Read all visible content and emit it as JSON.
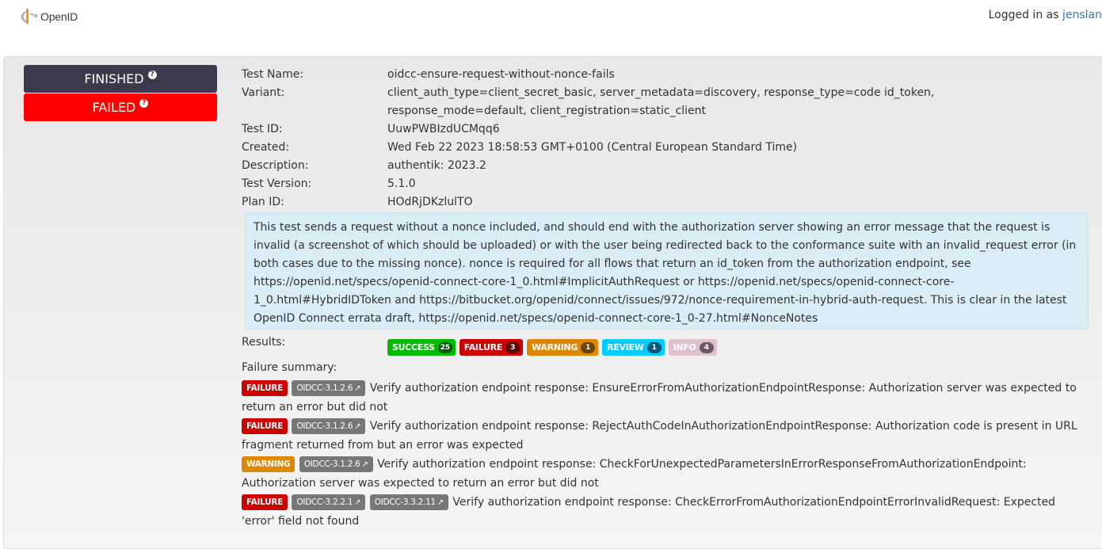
{
  "header": {
    "logo_text": "OpenID",
    "logged_in_prefix": "Logged in as",
    "username": "jenslan"
  },
  "status": {
    "run_state": "FINISHED",
    "result": "FAILED",
    "colors": {
      "finished": "#3b3a4c",
      "failed": "#ff0000"
    }
  },
  "details": [
    {
      "label": "Test Name:",
      "value": "oidcc-ensure-request-without-nonce-fails"
    },
    {
      "label": "Variant:",
      "value": "client_auth_type=client_secret_basic, server_metadata=discovery, response_type=code id_token, response_mode=default, client_registration=static_client"
    },
    {
      "label": "Test ID:",
      "value": "UuwPWBIzdUCMqq6"
    },
    {
      "label": "Created:",
      "value": "Wed Feb 22 2023 18:58:53 GMT+0100 (Central European Standard Time)"
    },
    {
      "label": "Description:",
      "value": "authentik: 2023.2"
    },
    {
      "label": "Test Version:",
      "value": "5.1.0"
    },
    {
      "label": "Plan ID:",
      "value": "HOdRjDKzlulTO"
    }
  ],
  "description_box": "This test sends a request without a nonce included, and should end with the authorization server showing an error message that the request is invalid (a screenshot of which should be uploaded) or with the user being redirected back to the conformance suite with an invalid_request error (in both cases due to the missing nonce). nonce is required for all flows that return an id_token from the authorization endpoint, see https://openid.net/specs/openid-connect-core-1_0.html#ImplicitAuthRequest or https://openid.net/specs/openid-connect-core-1_0.html#HybridIDToken and https://bitbucket.org/openid/connect/issues/972/nonce-requirement-in-hybrid-auth-request. This is clear in the latest OpenID Connect errata draft, https://openid.net/specs/openid-connect-core-1_0-27.html#NonceNotes",
  "results": {
    "label": "Results:",
    "badges": [
      {
        "label": "SUCCESS",
        "count": "25",
        "bg": "#00bb00",
        "count_bg": "#005a00",
        "fg": "#ffffff"
      },
      {
        "label": "FAILURE",
        "count": "3",
        "bg": "#cc0000",
        "count_bg": "#5e0000",
        "fg": "#ffffff"
      },
      {
        "label": "WARNING",
        "count": "1",
        "bg": "#dd8800",
        "count_bg": "#6b4200",
        "fg": "#ffffff"
      },
      {
        "label": "REVIEW",
        "count": "1",
        "bg": "#00ccff",
        "count_bg": "#005a75",
        "fg": "#ffffff"
      },
      {
        "label": "INFO",
        "count": "4",
        "bg": "#e0c0d0",
        "count_bg": "#6b5a62",
        "fg": "#ffffff"
      }
    ]
  },
  "failure_summary": {
    "label": "Failure summary:",
    "items": [
      {
        "level": "FAILURE",
        "refs": [
          "OIDCC-3.1.2.6"
        ],
        "text": "Verify authorization endpoint response: EnsureErrorFromAuthorizationEndpointResponse: Authorization server was expected to return an error but did not"
      },
      {
        "level": "FAILURE",
        "refs": [
          "OIDCC-3.1.2.6"
        ],
        "text": "Verify authorization endpoint response: RejectAuthCodeInAuthorizationEndpointResponse: Authorization code is present in URL fragment returned from but an error was expected"
      },
      {
        "level": "WARNING",
        "refs": [
          "OIDCC-3.1.2.6"
        ],
        "text": "Verify authorization endpoint response: CheckForUnexpectedParametersInErrorResponseFromAuthorizationEndpoint: Authorization server was expected to return an error but did not"
      },
      {
        "level": "FAILURE",
        "refs": [
          "OIDCC-3.2.2.1",
          "OIDCC-3.3.2.11"
        ],
        "text": "Verify authorization endpoint response: CheckErrorFromAuthorizationEndpointErrorInvalidRequest: Expected 'error' field not found"
      }
    ]
  }
}
